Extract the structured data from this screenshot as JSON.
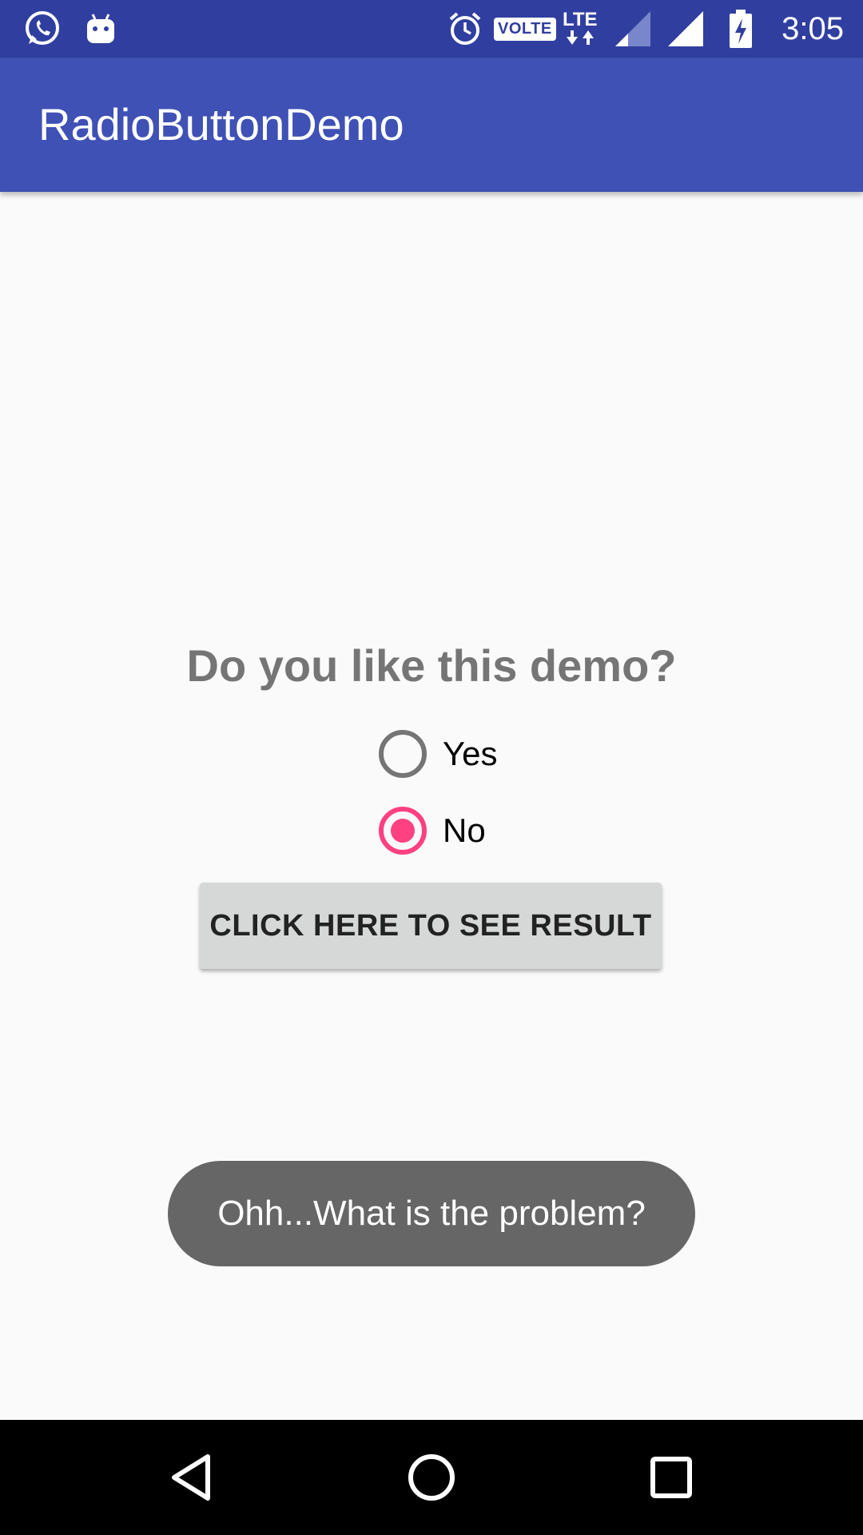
{
  "status_bar": {
    "time": "3:05",
    "volte": "VOLTE",
    "lte": "LTE",
    "icons": [
      "whatsapp-icon",
      "android-notification-icon",
      "alarm-icon",
      "volte-icon",
      "lte-icon",
      "signal-icon",
      "signal-full-icon",
      "battery-charging-icon"
    ]
  },
  "app_bar": {
    "title": "RadioButtonDemo"
  },
  "main": {
    "question": "Do you like this demo?",
    "options": [
      {
        "label": "Yes",
        "checked": false
      },
      {
        "label": "No",
        "checked": true
      }
    ],
    "button_label": "CLICK HERE TO SEE RESULT"
  },
  "toast": {
    "message": "Ohh...What is the problem?"
  },
  "nav_bar": {
    "icons": [
      "back-icon",
      "home-icon",
      "recents-icon"
    ]
  },
  "colors": {
    "status_bar": "#303f9f",
    "app_bar": "#3f51b5",
    "accent": "#ff4081",
    "background": "#fafafa",
    "toast": "#666666"
  }
}
